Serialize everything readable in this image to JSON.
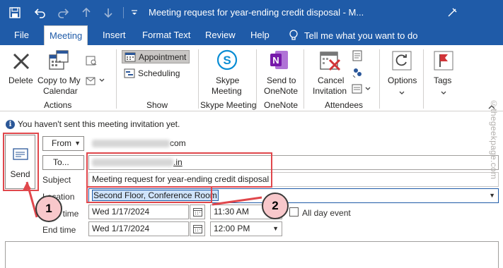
{
  "window": {
    "title": "Meeting request for year-ending credit disposal - M...",
    "icons": [
      "save-icon",
      "undo-icon",
      "redo-icon",
      "up-arrow-icon",
      "down-arrow-icon",
      "customize-dropdown-icon",
      "ribbon-pin-icon"
    ]
  },
  "tabs": [
    "File",
    "Meeting",
    "Insert",
    "Format Text",
    "Review",
    "Help"
  ],
  "active_tab": "Meeting",
  "tell_me": "Tell me what you want to do",
  "ribbon": {
    "actions": {
      "delete": "Delete",
      "copy_line1": "Copy to My",
      "copy_line2": "Calendar",
      "group": "Actions"
    },
    "show": {
      "appointment": "Appointment",
      "scheduling": "Scheduling",
      "group": "Show"
    },
    "skype": {
      "line1": "Skype",
      "line2": "Meeting",
      "group": "Skype Meeting"
    },
    "onenote": {
      "line1": "Send to",
      "line2": "OneNote",
      "group": "OneNote"
    },
    "attendees": {
      "line1": "Cancel",
      "line2": "Invitation",
      "group": "Attendees"
    },
    "options": {
      "label": "Options"
    },
    "tags": {
      "label": "Tags"
    }
  },
  "info_message": "You haven't sent this meeting invitation yet.",
  "form": {
    "send": "Send",
    "from_button": "From",
    "from_value_suffix": "com",
    "to_button": "To...",
    "to_value_suffix": ".in",
    "subject_label": "Subject",
    "subject_value": "Meeting request for year-ending credit disposal",
    "location_label": "Location",
    "location_value": "Second Floor, Conference Room",
    "start_label": "Start time",
    "start_date": "Wed 1/17/2024",
    "start_time": "11:30 AM",
    "all_day": "All day event",
    "all_day_checked": false,
    "end_label": "End time",
    "end_date": "Wed 1/17/2024",
    "end_time": "12:00 PM"
  },
  "annotations": {
    "callout_1": "1",
    "callout_2": "2",
    "highlight_color": "#e0474c"
  },
  "watermark": "©thegeekpage.com",
  "colors": {
    "accent": "#1f5ba8",
    "selection": "#cfe3fa"
  }
}
